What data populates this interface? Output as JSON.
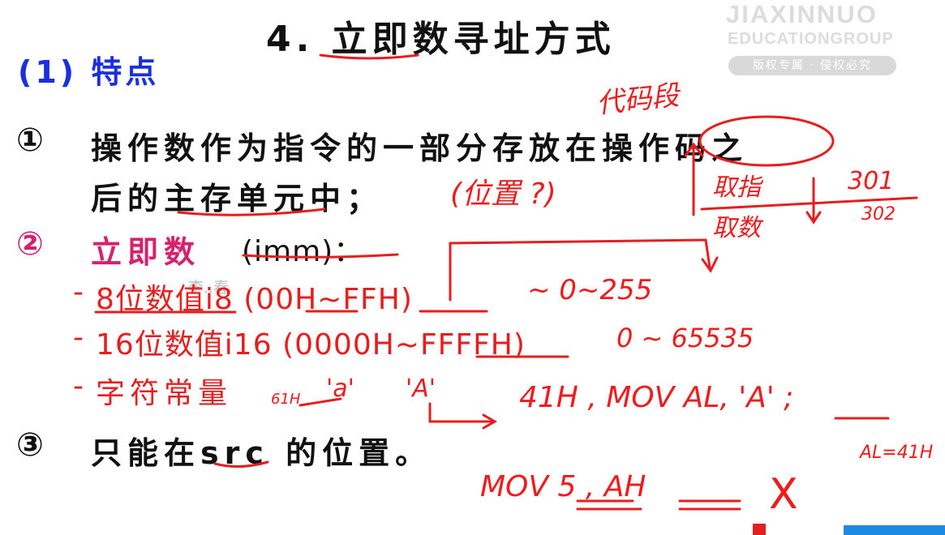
{
  "slide": {
    "title": "4. 立即数寻址方式",
    "subtitle": "(1) 特点",
    "watermark": {
      "brand": "JIAXINNUO",
      "brand_sub": "EDUCATIONGROUP",
      "notice": "版权专属 · 侵权必究",
      "name": "李..春"
    },
    "points": [
      {
        "marker": "①",
        "line1": "操作数作为指令的一部分存放在操作码之",
        "line2": "后的主存单元中；"
      },
      {
        "marker": "②",
        "label": "立即数",
        "suffix": "(imm)："
      },
      {
        "marker": "③",
        "text": "只能在src 的位置。"
      }
    ],
    "sub_items": [
      {
        "dash": "-",
        "text": "8位数值i8 (00H~FFH)"
      },
      {
        "dash": "-",
        "text": "16位数值i16 (0000H~FFFFH)"
      },
      {
        "dash": "-",
        "text": "字符常量"
      }
    ],
    "annotations": {
      "opcode_note": "代码段",
      "position_note": "(位置 ?)",
      "fetch_instr": "取指",
      "fetch_num": "取数",
      "addr1": "301",
      "addr2": "302",
      "range8": "~ 0~255",
      "range16": "0 ~ 65535",
      "char_61h": "61H",
      "char_a": "'a'",
      "char_A": "'A'",
      "char_41h": "41H , MOV AL, 'A' ;",
      "al_result": "AL=41H",
      "mov_bad": "MOV 5 , AH",
      "cross": "X"
    }
  }
}
